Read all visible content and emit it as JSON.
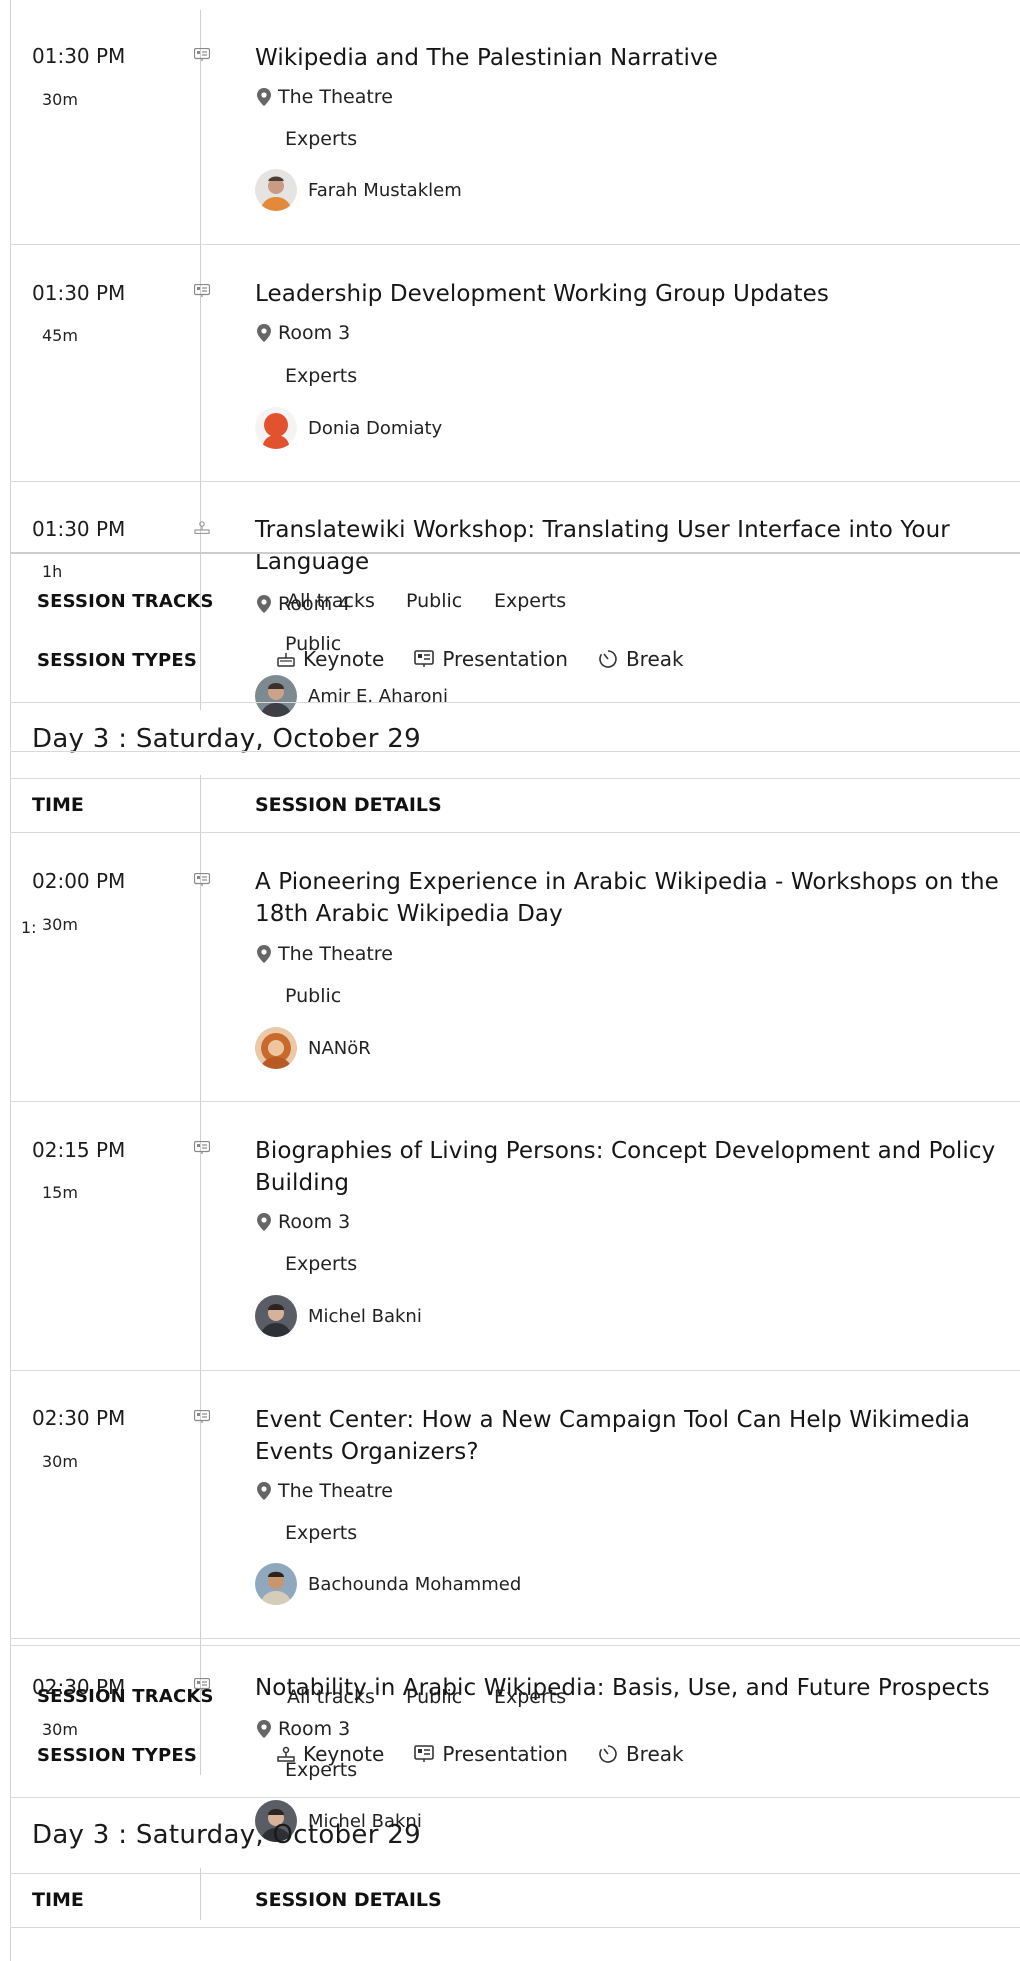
{
  "sessions_top": [
    {
      "time": "01:30 PM",
      "duration": "30m",
      "title": "Wikipedia and The Palestinian Narrative",
      "location": "The Theatre",
      "track": "Experts",
      "speaker": "Farah Mustaklem"
    },
    {
      "time": "01:30 PM",
      "duration": "45m",
      "title": "Leadership Development Working Group Updates",
      "location": "Room 3",
      "track": "Experts",
      "speaker": "Donia Domiaty"
    },
    {
      "time": "01:30 PM",
      "duration": "1h",
      "title": "Translatewiki Workshop: Translating User Interface into Your Language",
      "location": "Room 4",
      "track": "Public",
      "speaker": "Amir E. Aharoni"
    }
  ],
  "filters": {
    "tracks_label": "SESSION TRACKS",
    "types_label": "SESSION TYPES",
    "tracks": [
      "All tracks",
      "Public",
      "Experts"
    ],
    "types": [
      {
        "label": "Keynote",
        "icon": "keynote-icon"
      },
      {
        "label": "Presentation",
        "icon": "presentation-icon"
      },
      {
        "label": "Break",
        "icon": "break-icon"
      }
    ]
  },
  "day": {
    "heading": "Day 3 : Saturday, October 29",
    "col_time": "TIME",
    "col_details": "SESSION DETAILS",
    "stray_marker": "1:"
  },
  "sessions_day3": [
    {
      "time": "02:00 PM",
      "duration": "30m",
      "title": "A Pioneering Experience in Arabic Wikipedia - Workshops on the 18th Arabic Wikipedia Day",
      "location": "The Theatre",
      "track": "Public",
      "speaker": "NANöR"
    },
    {
      "time": "02:15 PM",
      "duration": "15m",
      "title": "Biographies of Living Persons: Concept Development and Policy Building",
      "location": "Room 3",
      "track": "Experts",
      "speaker": "Michel Bakni"
    },
    {
      "time": "02:30 PM",
      "duration": "30m",
      "title": "Event Center: How a New Campaign Tool Can Help Wikimedia Events Organizers?",
      "location": "The Theatre",
      "track": "Experts",
      "speaker": "Bachounda Mohammed"
    },
    {
      "time": "02:30 PM",
      "duration": "30m",
      "title": "Notability in Arabic Wikipedia: Basis, Use, and Future Prospects",
      "location": "Room 3",
      "track": "Experts",
      "speaker": "Michel Bakni"
    }
  ],
  "colors": {
    "rule": "#d9d9d9",
    "text": "#1f1f1f",
    "icon": "#777777"
  }
}
